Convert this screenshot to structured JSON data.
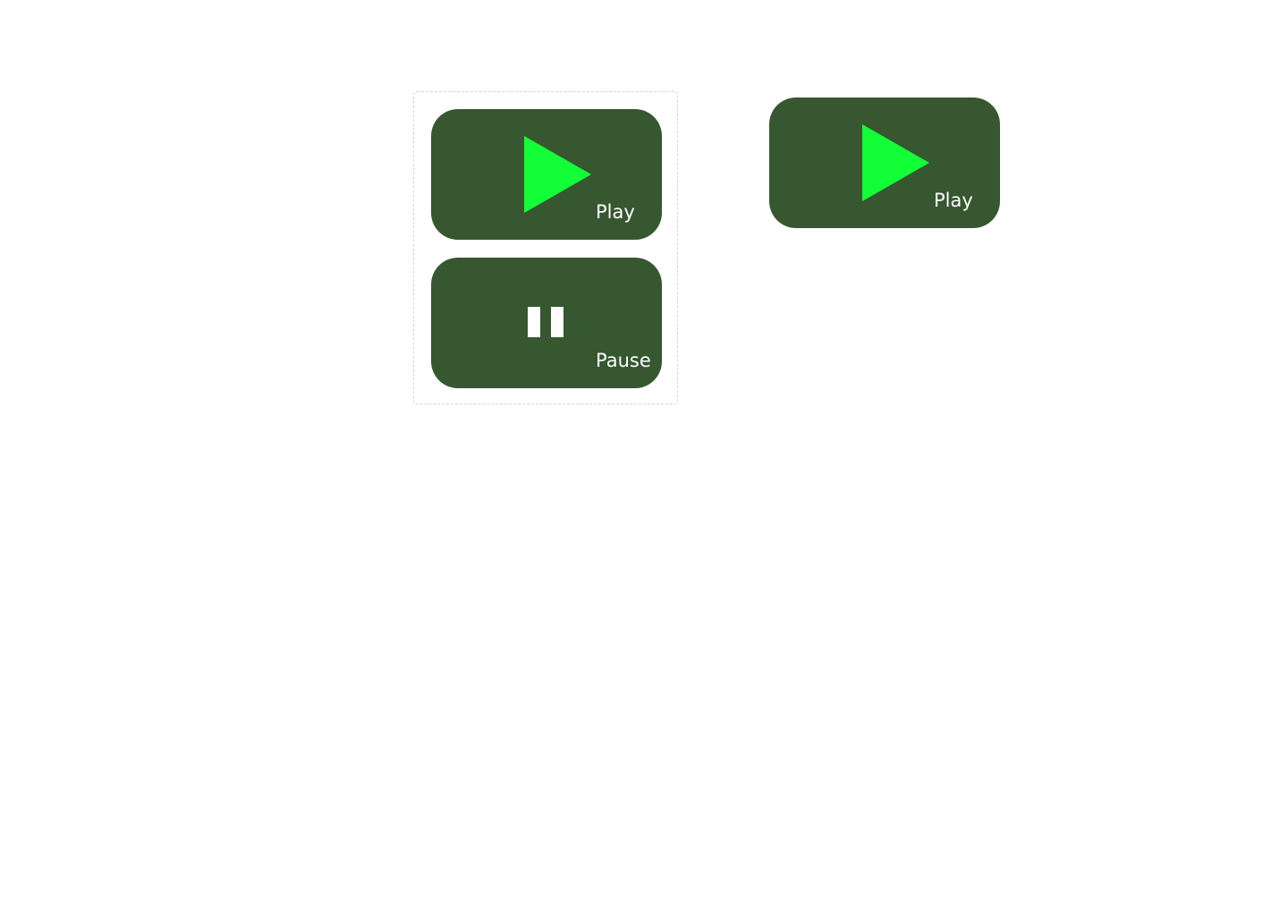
{
  "colors": {
    "button_bg": "#365730",
    "play_icon": "#12ff37",
    "label_text": "#ffffff",
    "group_border": "#d3d3d3",
    "page_bg": "#ffffff"
  },
  "variant_group": {
    "play_button": {
      "icon": "play-icon",
      "label": "Play"
    },
    "pause_button": {
      "icon": "pause-icon",
      "label": "Pause"
    }
  },
  "standalone": {
    "play_button": {
      "icon": "play-icon",
      "label": "Play"
    }
  }
}
